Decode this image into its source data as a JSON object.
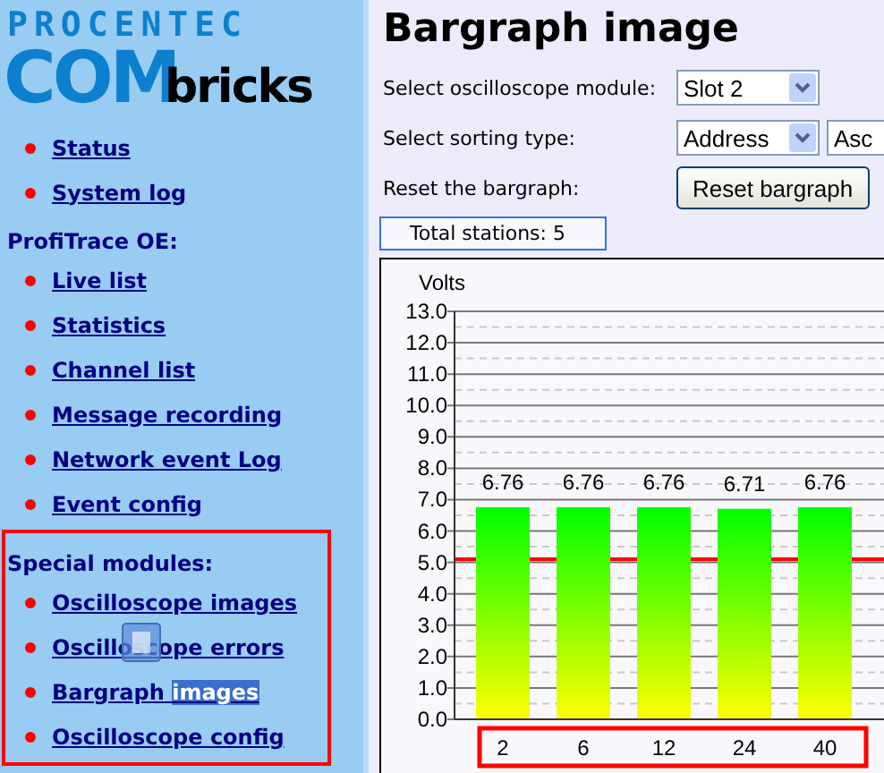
{
  "logo": {
    "top": "PROCENTEC",
    "main": "COM",
    "sub": "bricks"
  },
  "sidebar": {
    "sections": [
      {
        "highlighted": false,
        "items": [
          {
            "label": "Status"
          },
          {
            "label": "System log"
          }
        ]
      },
      {
        "heading": "ProfiTrace OE:",
        "highlighted": false,
        "items": [
          {
            "label": "Live list"
          },
          {
            "label": "Statistics"
          },
          {
            "label": "Channel list"
          },
          {
            "label": "Message recording"
          },
          {
            "label": "Network event Log"
          },
          {
            "label": "Event config"
          }
        ]
      },
      {
        "heading": "Special modules:",
        "highlighted": true,
        "items": [
          {
            "label": "Oscilloscope images"
          },
          {
            "label": "Oscilloscope errors"
          },
          {
            "label": "Bargraph ",
            "selected_text": "images"
          },
          {
            "label": "Oscilloscope config"
          }
        ]
      }
    ]
  },
  "title": "Bargraph image",
  "form": [
    {
      "label": "Select oscilloscope module:",
      "kind": "dropdowns",
      "values": [
        "Slot 2"
      ]
    },
    {
      "label": "Select sorting type:",
      "kind": "dropdowns",
      "values": [
        "Address",
        "Asc"
      ]
    },
    {
      "label": "Reset the bargraph:",
      "kind": "button",
      "button": "Reset bargraph"
    }
  ],
  "total_stations": "Total stations: 5",
  "chart": {
    "axis_highlighted": true,
    "chart_data": {
      "type": "bar",
      "ylabel": "Volts",
      "categories": [
        "2",
        "6",
        "12",
        "24",
        "40"
      ],
      "series": [
        {
          "color": "#00ff00",
          "values": [
            6.76,
            6.76,
            6.76,
            6.71,
            6.76
          ]
        }
      ],
      "grid": true,
      "value_labels": [
        "6.76",
        "6.76",
        "6.76",
        "6.71",
        "6.76"
      ],
      "ylim": [
        0,
        13
      ],
      "yticks": [
        {
          "value": 0,
          "label": "0.0"
        },
        {
          "value": 1,
          "label": "1.0"
        },
        {
          "value": 2,
          "label": "2.0"
        },
        {
          "value": 3,
          "label": "3.0"
        },
        {
          "value": 4,
          "label": "4.0"
        },
        {
          "value": 5,
          "label": "5.0"
        },
        {
          "value": 6,
          "label": "6.0"
        },
        {
          "value": 7,
          "label": "7.0"
        },
        {
          "value": 8,
          "label": "8.0"
        },
        {
          "value": 9,
          "label": "9.0"
        },
        {
          "value": 10,
          "label": "10.0"
        },
        {
          "value": 11,
          "label": "11.0"
        },
        {
          "value": 12,
          "label": "12.0"
        },
        {
          "value": 13,
          "label": "13.0"
        }
      ],
      "ref_lines": [
        {
          "axis": "y",
          "value": 5.1,
          "color": "#ff0000"
        }
      ]
    }
  }
}
